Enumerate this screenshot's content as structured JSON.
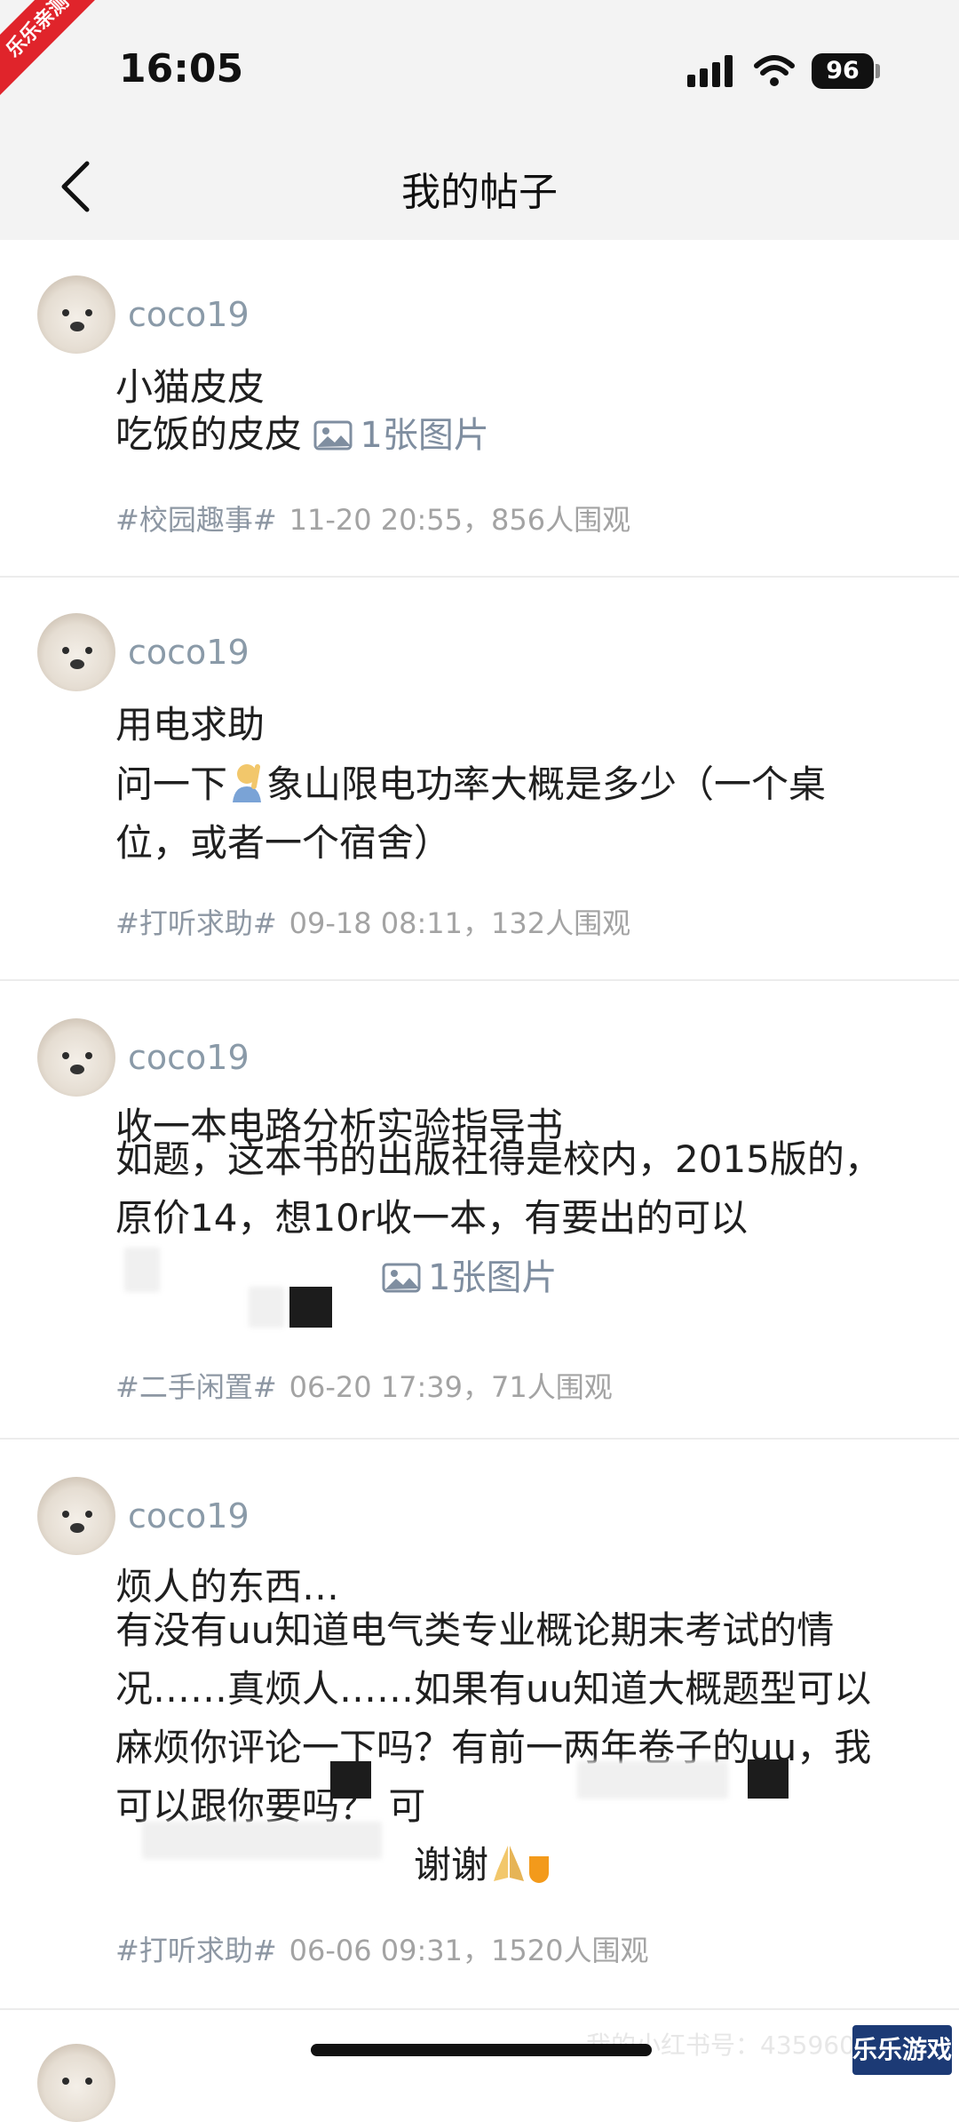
{
  "status_bar": {
    "time": "16:05",
    "battery": "96",
    "corner_badge": "乐乐亲测"
  },
  "nav": {
    "title": "我的帖子"
  },
  "posts": [
    {
      "username": "coco19",
      "title": "小猫皮皮",
      "body": "吃饭的皮皮",
      "image_count": "1张图片",
      "tag": "#校园趣事#",
      "meta": "11-20 20:55，856人围观"
    },
    {
      "username": "coco19",
      "title": "用电求助",
      "body_line1a": "问一下",
      "body_line1b": "象山限电功率大概是多少（一个桌",
      "body_line2": "位，或者一个宿舍）",
      "tag": "#打听求助#",
      "meta": "09-18 08:11，132人围观"
    },
    {
      "username": "coco19",
      "title": "收一本电路分析实验指导书",
      "body_line1": "如题，这本书的出版社得是校内，2015版的，",
      "body_line2": "原价14，想10r收一本，有要出的可以",
      "image_count": "1张图片",
      "tag": "#二手闲置#",
      "meta": "06-20 17:39，71人围观"
    },
    {
      "username": "coco19",
      "title": "烦人的东西…",
      "body_line1": "有没有uu知道电气类专业概论期末考试的情",
      "body_line2": "况……真烦人……如果有uu知道大概题型可以",
      "body_line3a": "麻烦你评论一下吗？有前一两年卷子的",
      "body_line3b": "uu，我",
      "body_line4": "可以跟你要吗？ 可",
      "body_line5": "谢谢",
      "tag": "#打听求助#",
      "meta": "06-06 09:31，1520人围观"
    }
  ],
  "watermarks": {
    "bottom_right": "乐乐游戏",
    "bottom_id": "我的小红书号：435960"
  },
  "colors": {
    "link": "#7f8ea0",
    "username": "#8a9aa8",
    "meta": "#a3a3a3",
    "badge": "#e0242b"
  },
  "icons": [
    "back-arrow-icon",
    "image-icon",
    "signal-icon",
    "wifi-icon",
    "battery-icon"
  ]
}
